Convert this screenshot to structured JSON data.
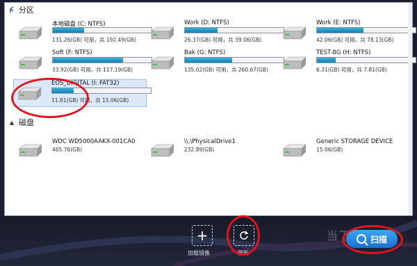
{
  "sections": {
    "partitions": "分区",
    "disks": "磁盘"
  },
  "partitions": [
    {
      "name": "本地磁盘 (C: NTFS)",
      "info": "131.26(GB) 可用，共 192.49(GB)",
      "used": 0.32
    },
    {
      "name": "Work (D: NTFS)",
      "info": "26.37(GB) 可用，共 39.06(GB)",
      "used": 0.33
    },
    {
      "name": "Work (E: NTFS)",
      "info": "42.06(GB) 可用，共 78.13(GB)",
      "used": 0.47
    },
    {
      "name": "Soft (F: NTFS)",
      "info": "33.92(GB) 可用，共 117.19(GB)",
      "used": 0.71
    },
    {
      "name": "Bak (G: NTFS)",
      "info": "135.02(GB) 可用，共 260.67(GB)",
      "used": 0.48
    },
    {
      "name": "TEST-8G (H: NTFS)",
      "info": "6.31(GB) 可用，共 7.81(GB)",
      "used": 0.19
    },
    {
      "name": "EOS_DIGITAL (I: FAT32)",
      "info": "11.81(GB) 可用，共 15.06(GB)",
      "used": 0.22
    }
  ],
  "disks": [
    {
      "name": "WDC WD5000AAKX-001CA0",
      "info": "465.76(GB)"
    },
    {
      "name": "\\\\.\\PhysicalDrive1",
      "info": "232.89(GB)"
    },
    {
      "name": "Generic STORAGE DEVICE",
      "info": "15.06(GB)"
    }
  ],
  "toolbar": {
    "load_image_label": "加载镜像",
    "refresh_label": "刷新",
    "scan_label": "扫描",
    "watermark": "当下软件园"
  },
  "colors": {
    "bar_fill": "#1a7fb5",
    "selected_bg": "#dbe9fb",
    "highlight_ring": "#e0141b",
    "scan_button": "#1a6fd2"
  }
}
